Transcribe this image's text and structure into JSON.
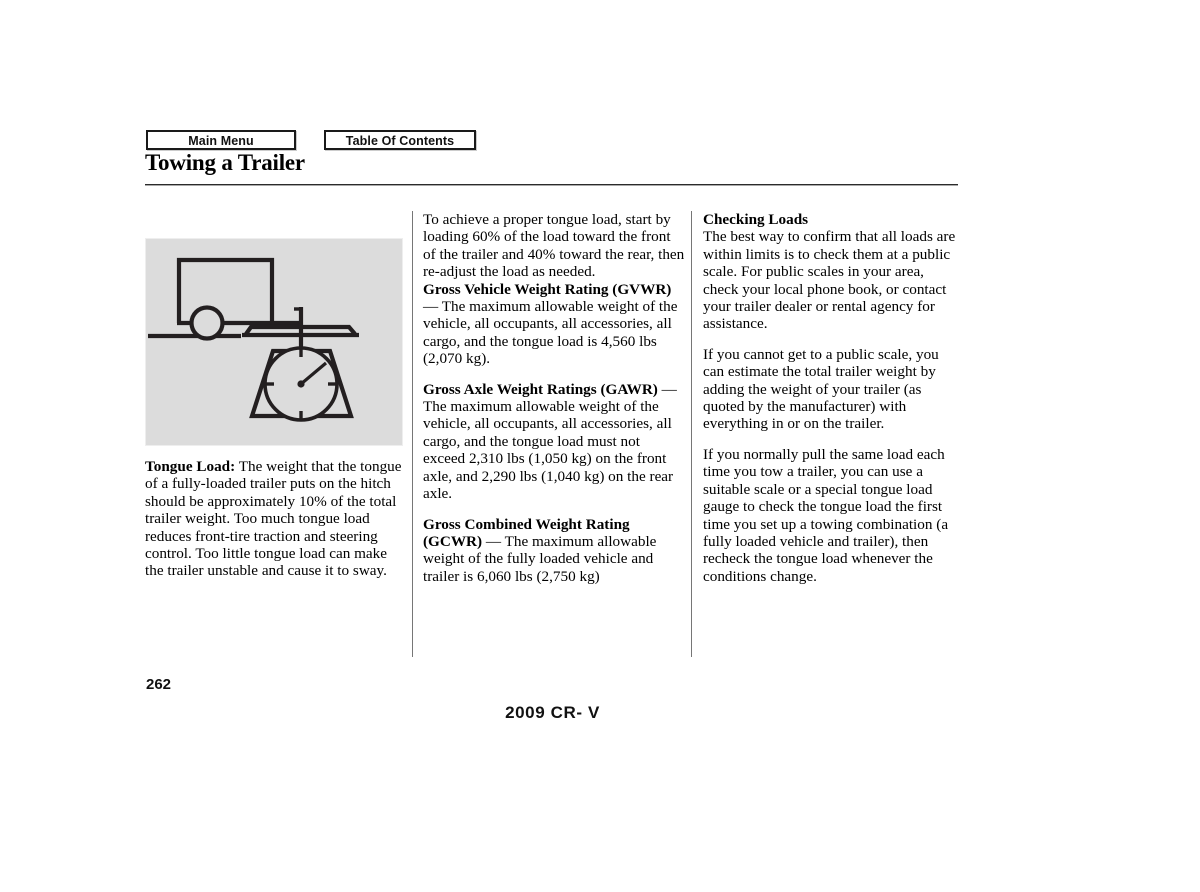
{
  "nav": {
    "main_menu_label": "Main Menu",
    "table_of_contents_label": "Table Of Contents"
  },
  "header": {
    "title": "Towing a Trailer"
  },
  "figure": {
    "alt_name": "trailer-tongue-on-scale-illustration",
    "background_color": "#dcdcdc",
    "line_color": "#231f20"
  },
  "left_column": {
    "caption_lead": "Tongue Load:",
    "caption_body": " The weight that the tongue of a fully-loaded trailer puts on the hitch should be approximately 10% of the total trailer weight. Too much tongue load reduces front-tire traction and steering control. Too little tongue load can make the trailer unstable and cause it to sway."
  },
  "middle_column": {
    "intro": "To achieve a proper tongue load, start by loading 60% of the load toward the front of the trailer and 40% toward the rear, then re-adjust the load as needed.",
    "sections": [
      {
        "heading": "Gross Vehicle Weight Rating (GVWR)",
        "dash": " — ",
        "body": "The maximum allowable weight of the vehicle, all occupants, all accessories, all cargo, and the tongue load is 4,560 lbs (2,070 kg)."
      },
      {
        "heading": "Gross Axle Weight Ratings (GAWR)",
        "dash": " — ",
        "body": "The maximum allowable weight of the vehicle, all occupants, all accessories, all cargo, and the tongue load must not exceed 2,310 lbs (1,050 kg) on the front axle, and 2,290 lbs (1,040 kg) on the rear axle."
      },
      {
        "heading": "Gross Combined Weight Rating (GCWR)",
        "dash": " — ",
        "body": "The maximum allowable weight of the fully loaded vehicle and trailer is 6,060 lbs (2,750 kg)"
      }
    ]
  },
  "right_column": {
    "heading": "Checking Loads",
    "paragraphs": [
      "The best way to confirm that all loads are within limits is to check them at a public scale. For public scales in your area, check your local phone book, or contact your trailer dealer or rental agency for assistance.",
      "If you cannot get to a public scale, you can estimate the total trailer weight by adding the weight of your trailer (as quoted by the manufacturer) with everything in or on the trailer.",
      "If you normally pull the same load each time you tow a trailer, you can use a suitable scale or a special tongue load gauge to check the tongue load the first time you set up a towing combination (a fully loaded vehicle and trailer), then recheck the tongue load whenever the conditions change."
    ]
  },
  "footer": {
    "page_number": "262",
    "model": "2009  CR- V"
  }
}
